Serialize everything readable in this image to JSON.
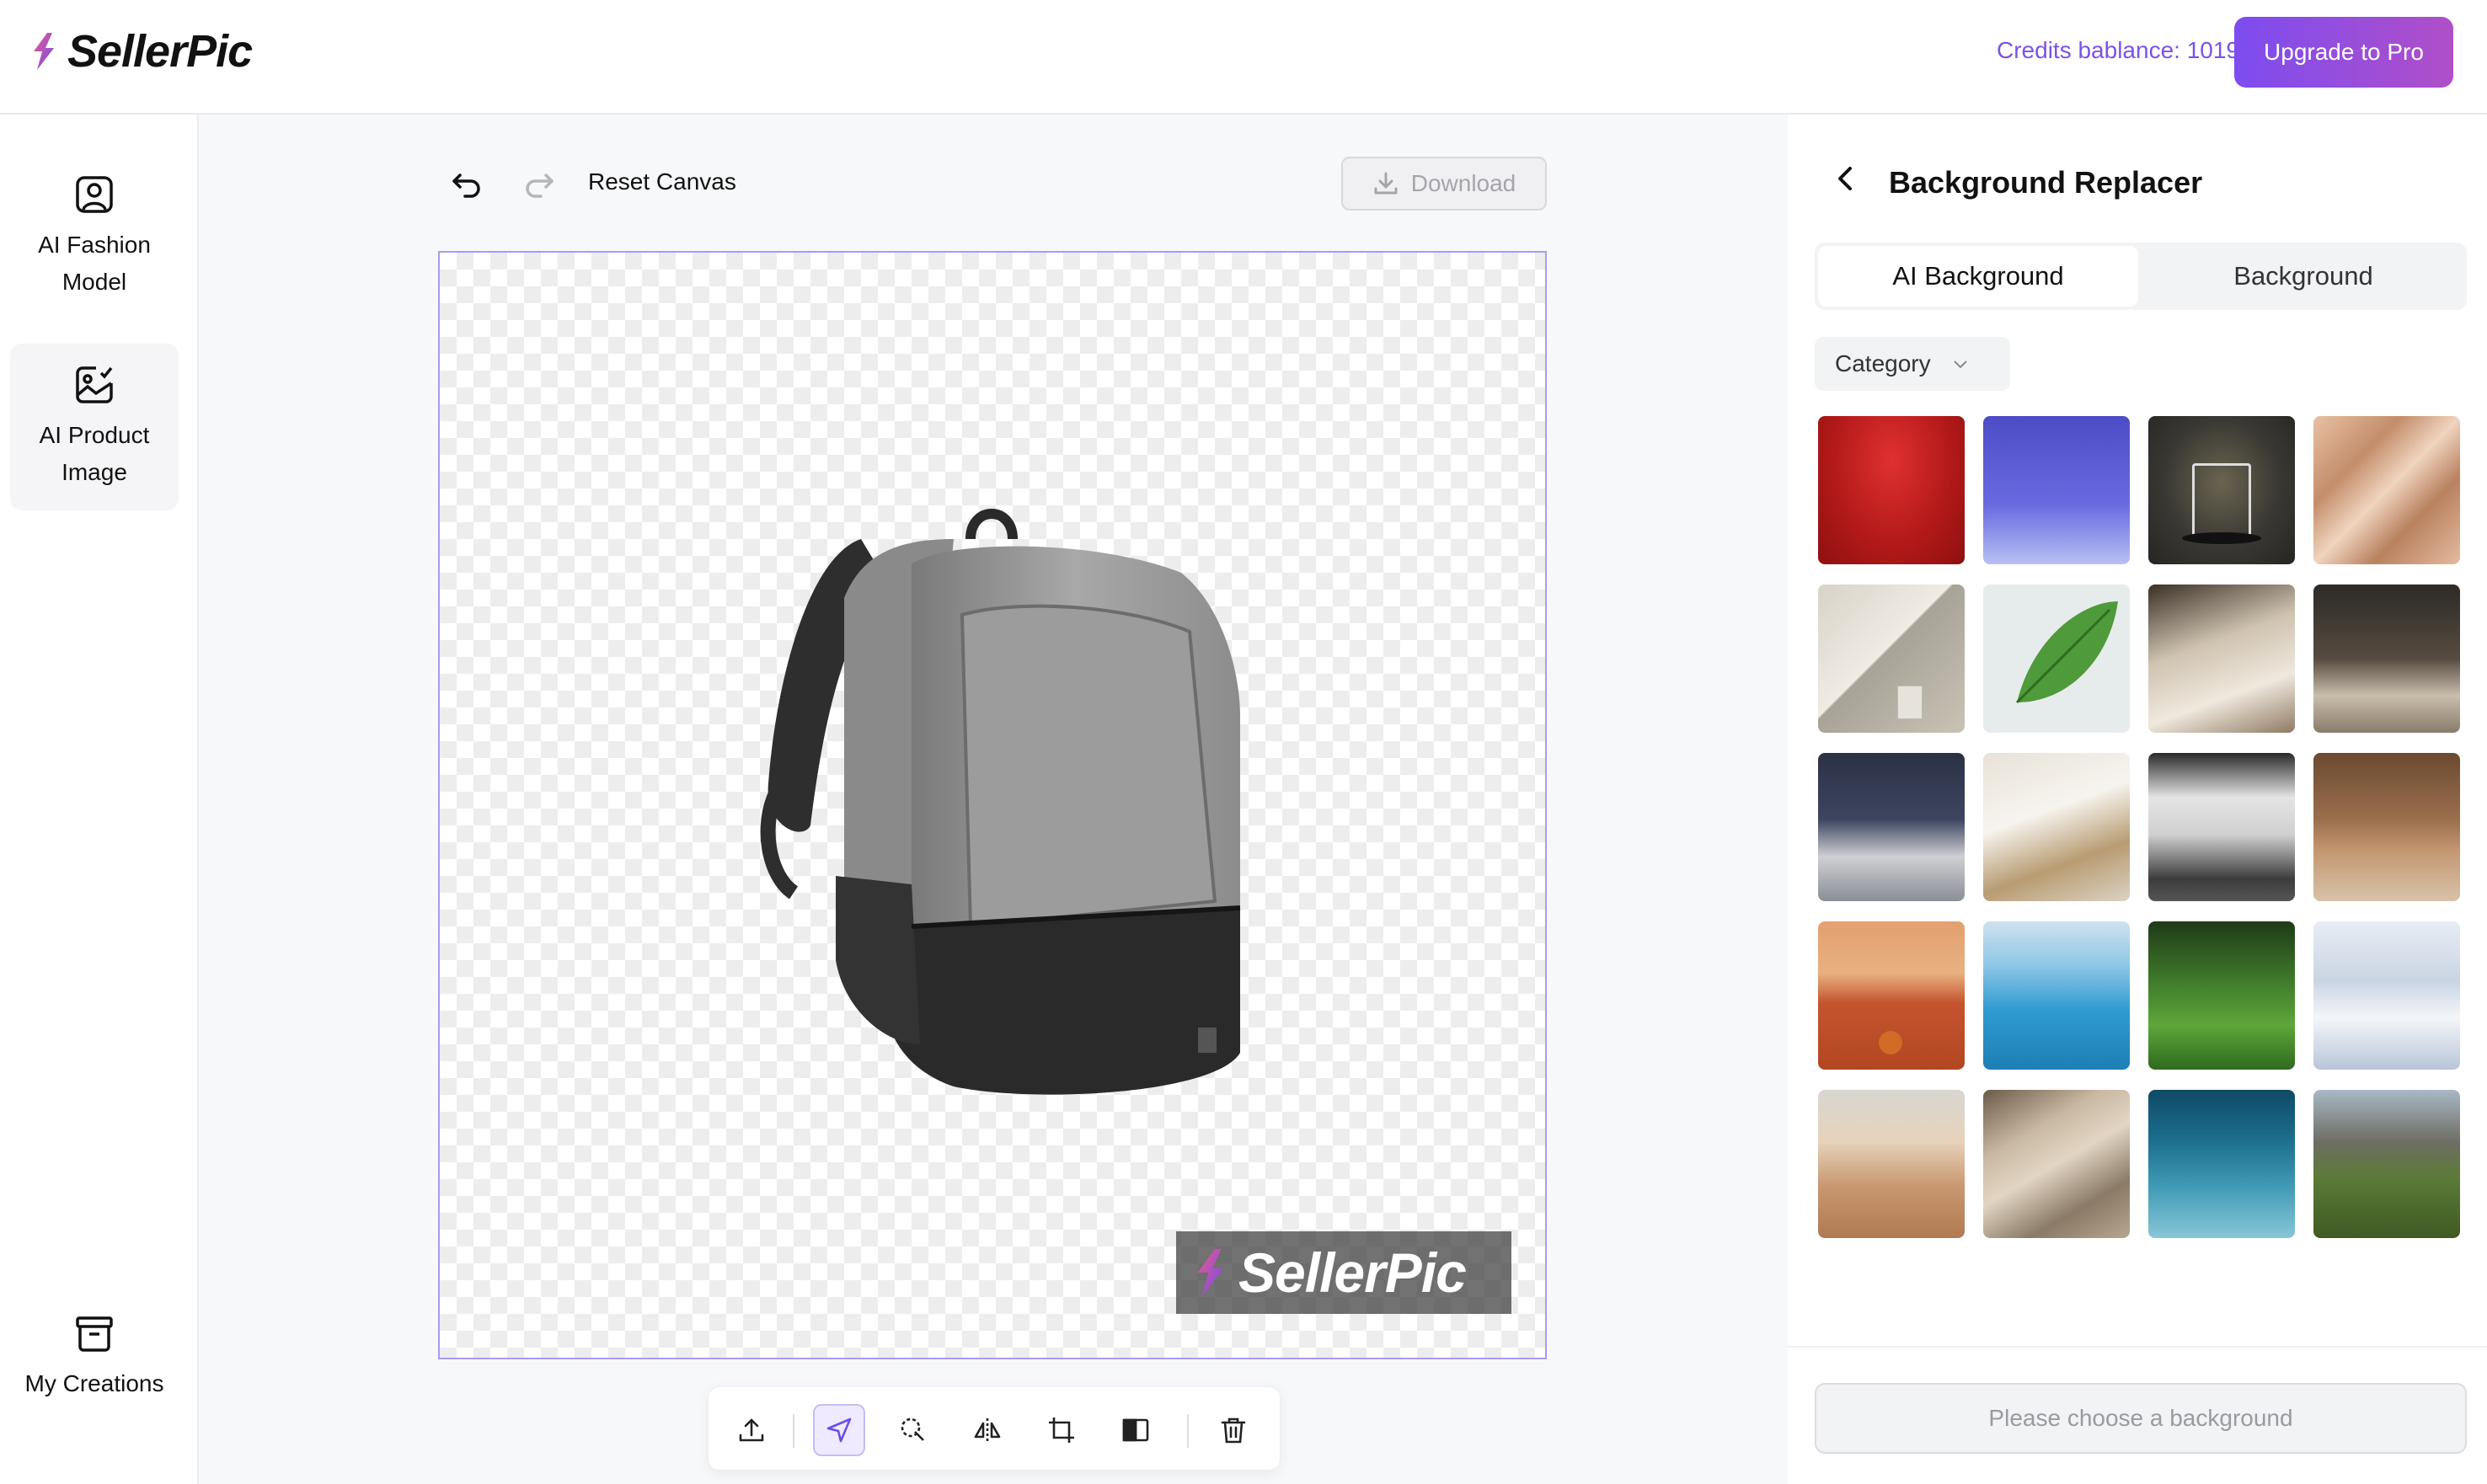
{
  "app": {
    "name": "SellerPic",
    "brand_gradient": [
      "#7d4cf0",
      "#b04fc8"
    ]
  },
  "header": {
    "credits": "Credits bablance: 1019",
    "upgrade_label": "Upgrade to Pro"
  },
  "leftnav": {
    "items": [
      {
        "label_1": "AI Fashion",
        "label_2": "Model",
        "icon": "fashion-model-icon"
      },
      {
        "label_1": "AI Product",
        "label_2": "Image",
        "icon": "product-image-icon",
        "active": true
      },
      {
        "label_1": "My Creations",
        "icon": "archive-icon"
      }
    ]
  },
  "canvas": {
    "undo_icon": "undo-icon",
    "redo_icon": "redo-icon",
    "reset_label": "Reset Canvas",
    "download_label": "Download",
    "watermark": "SellerPic",
    "toolbar": [
      "upload-icon",
      "select-pointer-icon",
      "lasso-select-icon",
      "flip-icon",
      "crop-icon",
      "compare-icon",
      "trash-icon"
    ]
  },
  "panel": {
    "title": "Background Replacer",
    "tabs": [
      "AI Background",
      "Background"
    ],
    "category_label": "Category",
    "choose_label": "Please choose a background",
    "thumbnails": [
      "red-studio",
      "blue-studio",
      "dark-pedestal",
      "satin-fabric",
      "shadow-wall",
      "green-leaf",
      "cozy-table",
      "bedroom",
      "office-desk",
      "window-room",
      "kitchen",
      "living-room",
      "tennis-court",
      "pool",
      "grass",
      "snow",
      "desert",
      "rocks",
      "underwater",
      "mountains"
    ]
  }
}
